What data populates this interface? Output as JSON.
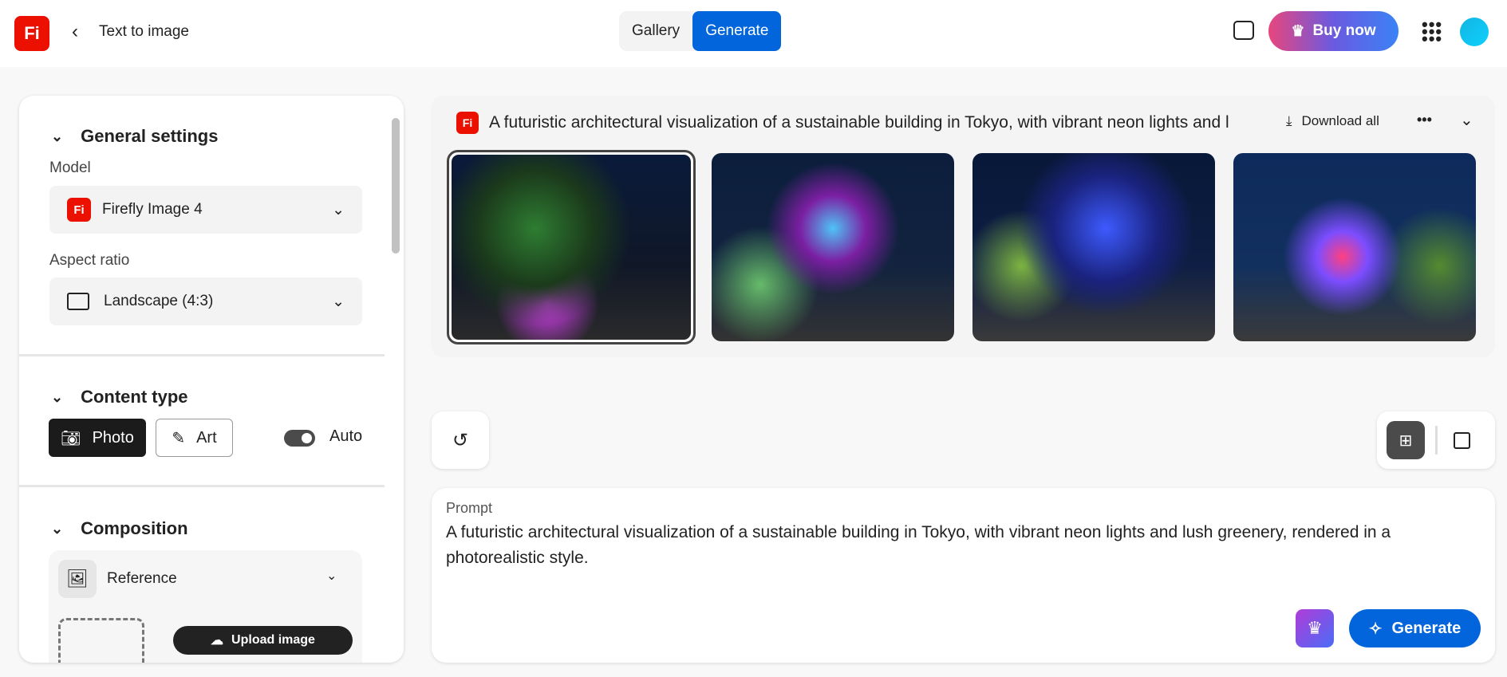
{
  "header": {
    "logo": "Fi",
    "back_label": "Text to image",
    "tabs": [
      "Gallery",
      "Generate"
    ],
    "active_tab": "Generate",
    "buy_label": "Buy now"
  },
  "settings": {
    "general": {
      "title": "General settings",
      "model_label": "Model",
      "model_value": "Firefly Image 4",
      "aspect_label": "Aspect ratio",
      "aspect_value": "Landscape (4:3)"
    },
    "content": {
      "title": "Content type",
      "photo": "Photo",
      "art": "Art",
      "auto": "Auto",
      "auto_on": true
    },
    "composition": {
      "title": "Composition",
      "reference": "Reference",
      "upload": "Upload image"
    }
  },
  "results": {
    "prompt_title": "A futuristic architectural visualization of a sustainable building in Tokyo, with vibrant neon lights and l",
    "download_all": "Download all",
    "images": [
      "Generated image 1",
      "Generated image 2",
      "Generated image 3",
      "Generated image 4"
    ],
    "selected_index": 0
  },
  "prompt": {
    "label": "Prompt",
    "text": "A futuristic architectural visualization of a sustainable building in Tokyo, with vibrant neon lights and lush greenery, rendered in a photorealistic style.",
    "generate_label": "Generate"
  }
}
